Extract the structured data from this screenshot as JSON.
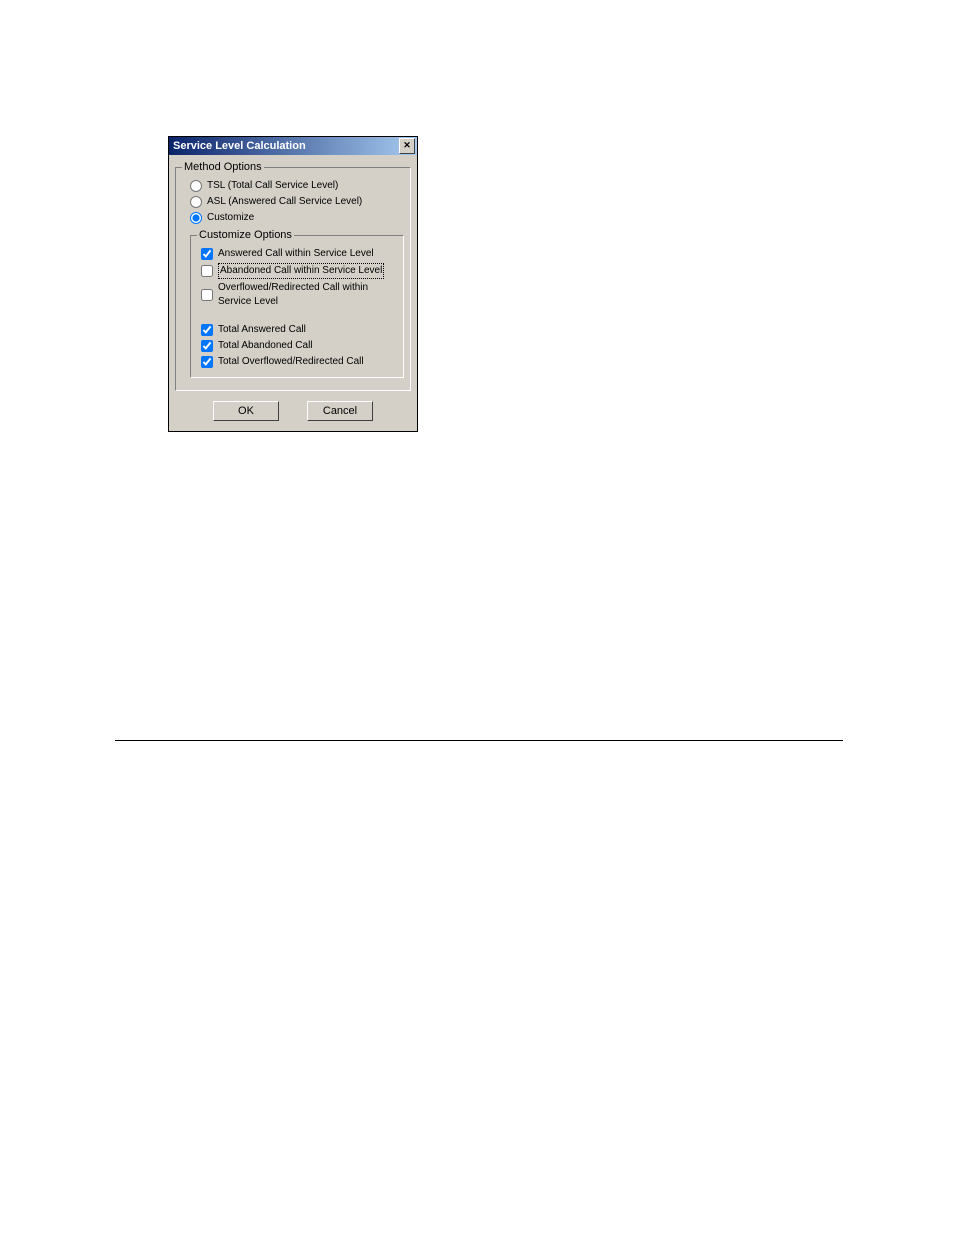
{
  "dialog": {
    "title": "Service Level Calculation",
    "close_glyph": "✕",
    "method_options": {
      "legend": "Method Options",
      "tsl_label": "TSL (Total Call Service Level)",
      "asl_label": "ASL (Answered Call Service Level)",
      "customize_label": "Customize"
    },
    "customize_options": {
      "legend": "Customize Options",
      "answered_within": "Answered Call within Service Level",
      "abandoned_within": "Abandoned Call within Service Level",
      "overflow_within": "Overflowed/Redirected Call within Service Level",
      "total_answered": "Total Answered Call",
      "total_abandoned": "Total Abandoned Call",
      "total_overflow": "Total Overflowed/Redirected Call"
    },
    "buttons": {
      "ok": "OK",
      "cancel": "Cancel"
    }
  }
}
